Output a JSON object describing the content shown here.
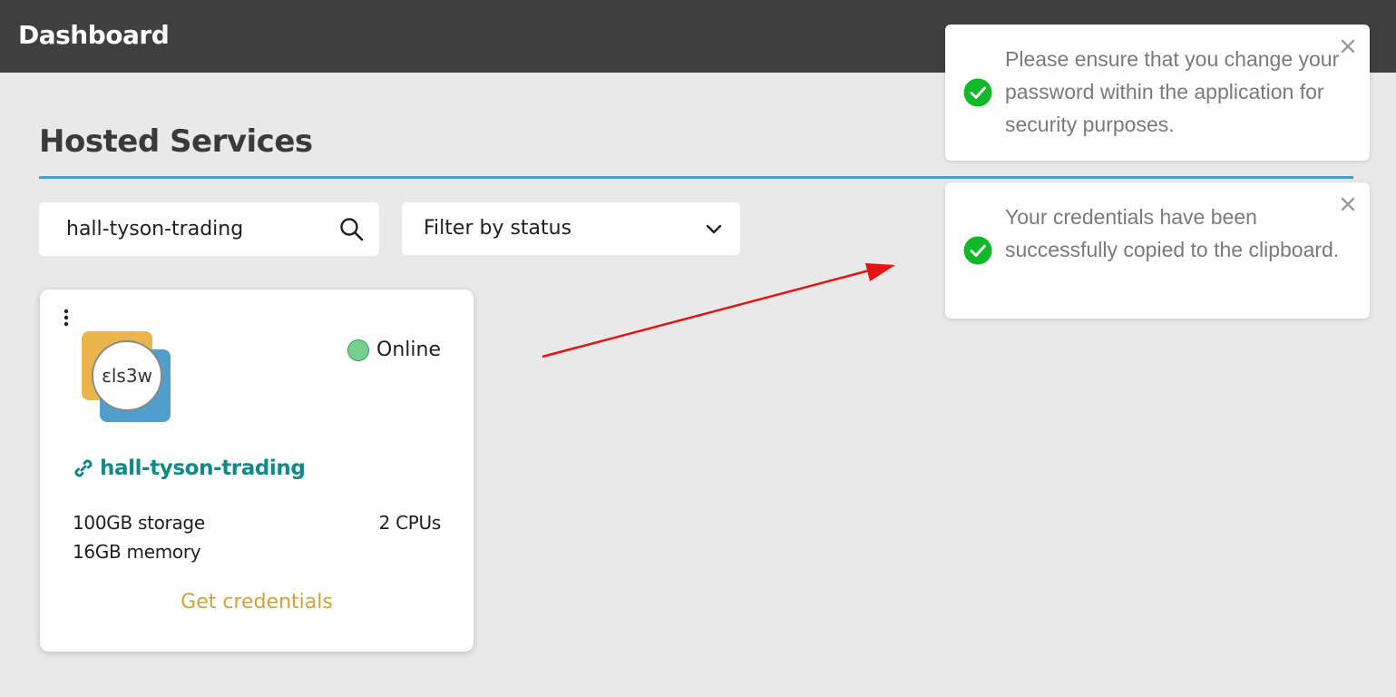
{
  "topbar": {
    "title": "Dashboard"
  },
  "page": {
    "section_title": "Hosted Services"
  },
  "search": {
    "value": "hall-tyson-trading",
    "icon": "search-icon"
  },
  "status_filter": {
    "label": "Filter by status",
    "icon": "chevron-down-icon"
  },
  "service_card": {
    "menu_icon": "kebab-menu-icon",
    "logo_text": "ԑls3w",
    "status": {
      "label": "Online",
      "color": "#74d08c"
    },
    "name": "hall-tyson-trading",
    "link_icon": "link-icon",
    "storage": "100GB storage",
    "memory": "16GB memory",
    "cpus": "2 CPUs",
    "action_label": "Get credentials"
  },
  "toasts": [
    {
      "message": "Please ensure that you change your password within the application for security purposes.",
      "icon": "check-circle-icon"
    },
    {
      "message": "Your credentials have been successfully copied to the clipboard.",
      "icon": "check-circle-icon"
    }
  ],
  "colors": {
    "topbar": "#3f3f3f",
    "background": "#e9e9e9",
    "rule": "#4a9ec9",
    "link": "#0f8a84",
    "action": "#d4a236",
    "success": "#10b82a",
    "annotation_arrow": "#e81010"
  }
}
